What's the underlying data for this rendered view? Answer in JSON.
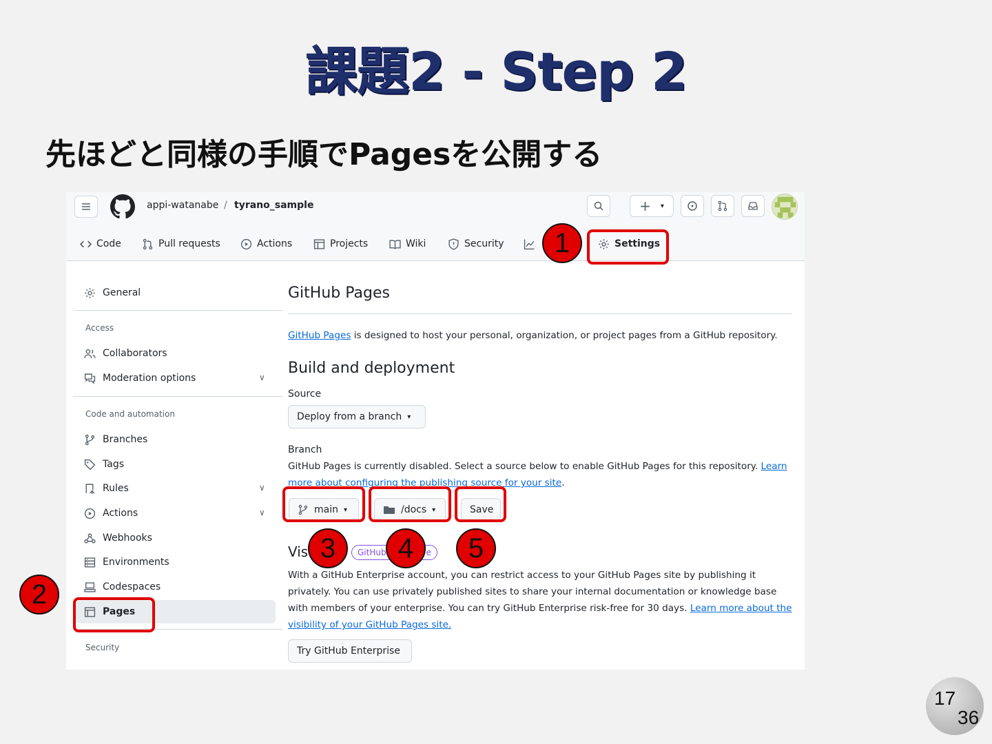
{
  "slide": {
    "title": "課題2 - Step 2",
    "subtitle": "先ほどと同様の手順でPagesを公開する",
    "page_current": "17",
    "page_total": "36"
  },
  "github": {
    "owner": "appi-watanabe",
    "separator": "/",
    "repo": "tyrano_sample",
    "tabs": [
      "Code",
      "Pull requests",
      "Actions",
      "Projects",
      "Wiki",
      "Security",
      "Insights",
      "Settings"
    ],
    "sidebar": {
      "general": "General",
      "access_heading": "Access",
      "collaborators": "Collaborators",
      "moderation": "Moderation options",
      "code_heading": "Code and automation",
      "branches": "Branches",
      "tags": "Tags",
      "rules": "Rules",
      "actions": "Actions",
      "webhooks": "Webhooks",
      "environments": "Environments",
      "codespaces": "Codespaces",
      "pages": "Pages",
      "security_heading": "Security"
    },
    "main": {
      "title": "GitHub Pages",
      "intro_link": "GitHub Pages",
      "intro_text": " is designed to host your personal, organization, or project pages from a GitHub repository.",
      "build_title": "Build and deployment",
      "source_label": "Source",
      "source_value": "Deploy from a branch",
      "branch_label": "Branch",
      "branch_text": "GitHub Pages is currently disabled. Select a source below to enable GitHub Pages for this repository. ",
      "branch_link_1": "Learn",
      "branch_link_2": "more about configuring the publishing source for your site",
      "branch_select": "main",
      "folder_select": "/docs",
      "save": "Save",
      "visibility_title": "Visi",
      "visibility_badge": "GitHub",
      "visibility_badge_end": "e",
      "vis_line1": "With a GitHub Enterprise account, you can restrict access to your GitHub Pages site by publishing it",
      "vis_line2": "privately. You can use privately published sites to share your internal documentation or knowledge base",
      "vis_line3": "with members of your enterprise. You can try GitHub Enterprise risk-free for 30 days. ",
      "vis_link_1": "Learn more about the",
      "vis_link_2": "visibility of your GitHub Pages site.",
      "try_enterprise": "Try GitHub Enterprise"
    }
  },
  "callouts": [
    "1",
    "2",
    "3",
    "4",
    "5"
  ],
  "colors": {
    "highlight": "#e00000",
    "title": "#1f2f6b",
    "link": "#0969da"
  }
}
